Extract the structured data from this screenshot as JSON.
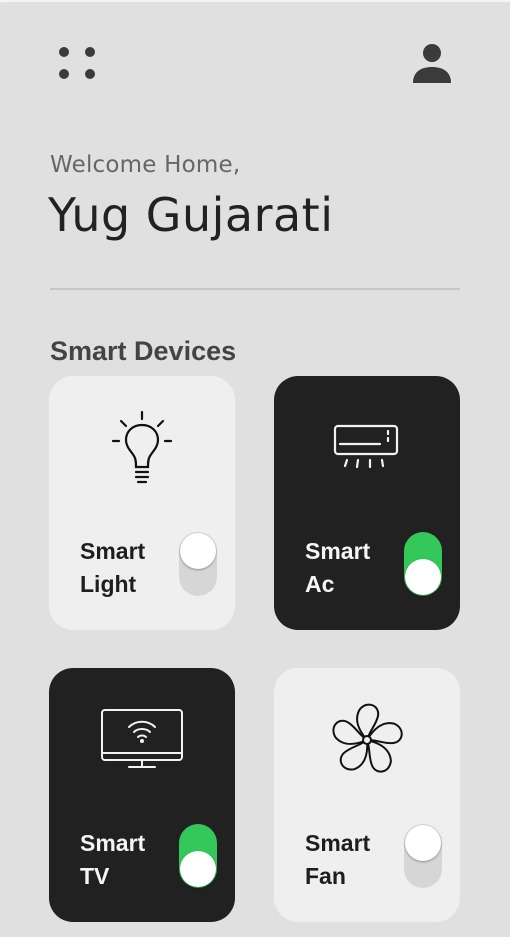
{
  "header": {
    "menu_icon": "grid-menu-icon",
    "profile_icon": "person-icon"
  },
  "greeting": {
    "welcome": "Welcome Home,",
    "name": "Yug Gujarati"
  },
  "section": {
    "title": "Smart Devices"
  },
  "colors": {
    "background": "#e0e0e0",
    "card_off": "#efefef",
    "card_on": "#212121",
    "toggle_on": "#34c759",
    "toggle_off": "#d6d6d6"
  },
  "devices": [
    {
      "line1": "Smart",
      "line2": "Light",
      "icon": "light-bulb-icon",
      "on": false
    },
    {
      "line1": "Smart",
      "line2": "Ac",
      "icon": "air-conditioner-icon",
      "on": true
    },
    {
      "line1": "Smart",
      "line2": "TV",
      "icon": "smart-tv-icon",
      "on": true
    },
    {
      "line1": "Smart",
      "line2": "Fan",
      "icon": "fan-icon",
      "on": false
    }
  ]
}
